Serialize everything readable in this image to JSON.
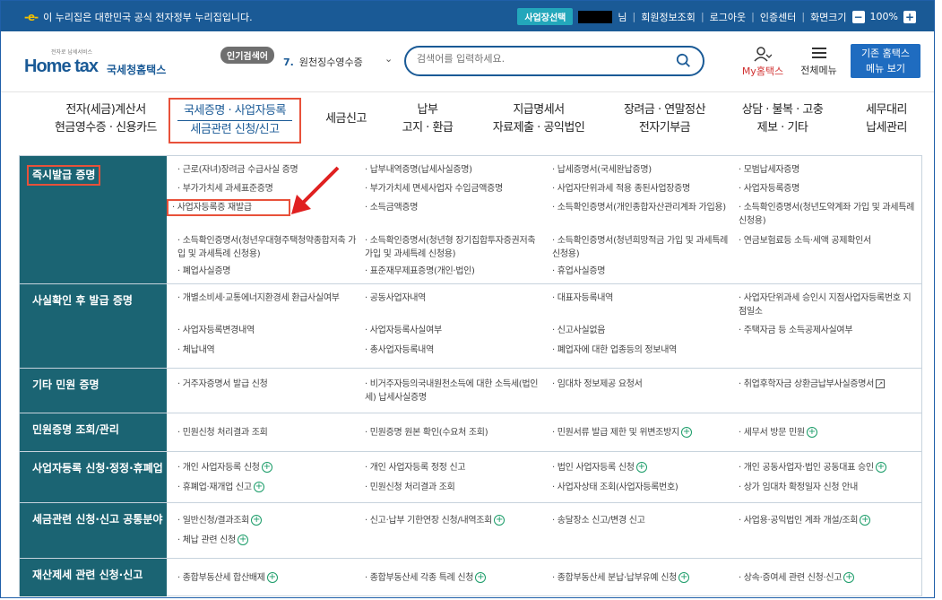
{
  "topbar": {
    "gov_notice": "이 누리집은 대한민국 공식 전자정부 누리집입니다.",
    "biz_select": "사업장선택",
    "suffix": "님",
    "member_info": "회원정보조회",
    "logout": "로그아웃",
    "cert_center": "인증센터",
    "screen_size": "화면크기",
    "zoom_minus": "−",
    "zoom": "100%",
    "zoom_plus": "+"
  },
  "header": {
    "logo_small": "전자로 납세서비스",
    "logo_main": "Home tax",
    "logo_kr": "국세청홈택스",
    "popular_badge": "인기검색어",
    "popular_num": "7.",
    "popular_text": "원천징수영수증",
    "search_placeholder": "검색어를 입력하세요.",
    "my_label": "My홈택스",
    "allmenu_label": "전체메뉴",
    "old_home_1": "기존 홈택스",
    "old_home_2": "메뉴 보기"
  },
  "gnb": [
    {
      "l1": "전자(세금)계산서",
      "l2": "현금영수증 · 신용카드"
    },
    {
      "l1": "국세증명 · 사업자등록",
      "l2": "세금관련 신청/신고"
    },
    {
      "l1": "세금신고",
      "l2": ""
    },
    {
      "l1": "납부",
      "l2": "고지 · 환급"
    },
    {
      "l1": "지급명세서",
      "l2": "자료제출 · 공익법인"
    },
    {
      "l1": "장려금 · 연말정산",
      "l2": "전자기부금"
    },
    {
      "l1": "상담 · 불복 · 고충",
      "l2": "제보 · 기타"
    },
    {
      "l1": "세무대리",
      "l2": "납세관리"
    }
  ],
  "sections": [
    {
      "title": "즉시발급 증명",
      "items": [
        "근로(자녀)장려금 수급사실 증명",
        "납부내역증명(납세사실증명)",
        "납세증명서(국세완납증명)",
        "모범납세자증명",
        "부가가치세 과세표준증명",
        "부가가치세 면세사업자 수입금액증명",
        "사업자단위과세 적용 종된사업장증명",
        "사업자등록증명",
        "사업자등록증 재발급",
        "소득금액증명",
        "소득확인증명서(개인종합자산관리계좌 가입용)",
        "소득확인증명서(청년도약계좌 가입 및 과세특례 신청용)",
        "소득확인증명서(청년우대형주택청약종합저축 가입 및 과세특례 신청용)",
        "소득확인증명서(청년형 장기집합투자증권저축 가입 및 과세특례 신청용)",
        "소득확인증명서(청년희망적금 가입 및 과세특례 신청용)",
        "연금보험료등 소득·세액 공제확인서",
        "폐업사실증명",
        "표준재무제표증명(개인·법인)",
        "휴업사실증명"
      ]
    },
    {
      "title": "사실확인 후 발급 증명",
      "items": [
        "개별소비세·교통에너지환경세 환급사실여부",
        "공동사업자내역",
        "대표자등록내역",
        "사업자단위과세 승인시 지점사업자등록번호 지점일소",
        "사업자등록변경내역",
        "사업자등록사실여부",
        "신고사실없음",
        "주택자금 등 소득공제사실여부",
        "체납내역",
        "총사업자등록내역",
        "폐업자에 대한 업종등의 정보내역"
      ]
    },
    {
      "title": "기타 민원 증명",
      "items": [
        "거주자증명서 발급 신청",
        "비거주자등의국내원천소득에 대한 소득세(법인세) 납세사실증명",
        "임대차 정보제공 요청서",
        "취업후학자금 상환금납부사실증명서"
      ]
    },
    {
      "title": "민원증명 조회/관리",
      "items": [
        "민원신청 처리결과 조회",
        "민원증명 원본 확인(수요처 조회)",
        "민원서류 발급 제한 및 위변조방지",
        "세무서 방문 민원"
      ]
    },
    {
      "title": "사업자등록 신청·정정·휴폐업",
      "items": [
        "개인 사업자등록 신청",
        "개인 사업자등록 정정 신고",
        "법인 사업자등록 신청",
        "개인 공동사업자·법인 공동대표 승인",
        "휴폐업·재개업 신고",
        "민원신청 처리결과 조회",
        "사업자상태 조회(사업자등록번호)",
        "상가 임대차 확정일자 신청 안내"
      ]
    },
    {
      "title": "세금관련 신청·신고 공통분야",
      "items": [
        "일반신청/결과조회",
        "신고·납부 기한연장 신청/내역조회",
        "송달장소 신고/변경 신고",
        "사업용·공익법인 계좌 개설/조회",
        "체납 관련 신청"
      ]
    },
    {
      "title": "재산제세 관련 신청·신고",
      "items": [
        "종합부동산세 합산배제",
        "종합부동산세 각종 특례 신청",
        "종합부동산세 분납·납부유예 신청",
        "상속·증여세 관련 신청·신고"
      ]
    }
  ]
}
